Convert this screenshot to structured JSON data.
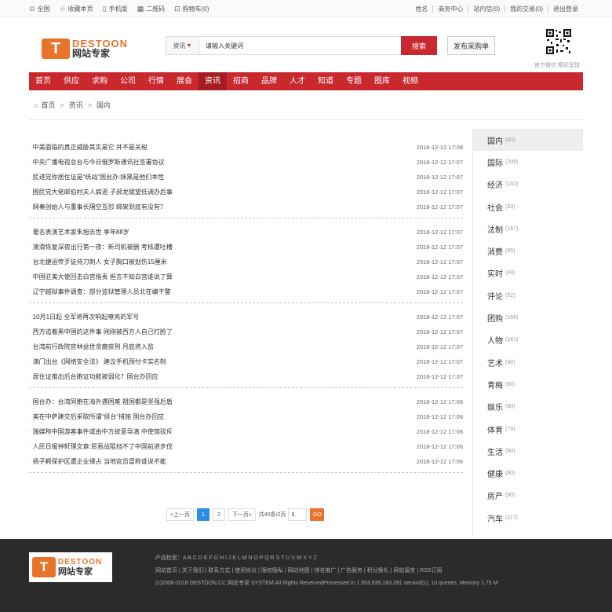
{
  "topbar": {
    "left": [
      {
        "icon": "location-icon",
        "label": "全国"
      },
      {
        "icon": "star-icon",
        "label": "收藏本页"
      },
      {
        "icon": "mobile-icon",
        "label": "手机版"
      },
      {
        "icon": "qrcode-icon",
        "label": "二维码"
      },
      {
        "icon": "cart-icon",
        "label": "购物车(0)"
      }
    ],
    "right": [
      "姓名",
      "商务中心",
      "站内信(0)",
      "我的交易(0)",
      "退出登录"
    ]
  },
  "header": {
    "logo_en": "DESTOON",
    "logo_cn": "网站专家",
    "search_type": "资讯",
    "search_value": "请输入关键词",
    "search_button": "搜索",
    "publish_button": "发布采购单",
    "qr_caption": "官方微信 精彩呈现"
  },
  "nav": {
    "active": 6,
    "items": [
      "首页",
      "供应",
      "求购",
      "公司",
      "行情",
      "展会",
      "资讯",
      "招商",
      "品牌",
      "人才",
      "知道",
      "专题",
      "图库",
      "视频"
    ]
  },
  "breadcrumb": [
    "首页",
    "资讯",
    "国内"
  ],
  "news_groups": [
    [
      {
        "title": "中美面临的真正威胁其实是它 并不是关税",
        "date": "2018-12-12 17:08"
      },
      {
        "title": "中央广播电视总台与今日俄罗斯通讯社签署协议",
        "date": "2018-12-12 17:07"
      },
      {
        "title": "民进党你居住证是“统战”国台办:抹黑是他们本性",
        "date": "2018-12-12 17:07"
      },
      {
        "title": "国民党大佬邮伯村夫人病逝 子郝龙斌望低调办后事",
        "date": "2018-12-12 17:07"
      },
      {
        "title": "网奏创始人与董事长隔空互怼 绑架到底有没有？",
        "date": "2018-12-12 17:07"
      }
    ],
    [
      {
        "title": "著名表演艺术家朱旭去世 享年88岁",
        "date": "2018-12-12 17:07"
      },
      {
        "title": "澳滑恢复深夜出行第一夜：新司机被删 考核遭吐槽",
        "date": "2018-12-12 17:07"
      },
      {
        "title": "台北捷运传歹徒持刀刺人 女子胸口被划伤15厘米",
        "date": "2018-12-12 17:07"
      },
      {
        "title": "中国驻美大使回击白宫指责 担言不知白宫谁说了算",
        "date": "2018-12-12 17:07"
      },
      {
        "title": "辽宁越狱事件调查：部分监狱管理人员北在编干警",
        "date": "2018-12-12 17:07"
      }
    ],
    [
      {
        "title": "10月1日起 全军将再次响起嘹亮的军号",
        "date": "2018-12-12 17:07"
      },
      {
        "title": "西方追着黑中国的这件事 刚刚被西方人自己打脸了",
        "date": "2018-12-12 17:07"
      },
      {
        "title": "台湾前行政院官林益世贪腐获刑 月底将入监",
        "date": "2018-12-12 17:07"
      },
      {
        "title": "澳门出台《网络安全法》 建议手机预付卡实名制",
        "date": "2018-12-12 17:07"
      },
      {
        "title": "居住证推出后台胞证功能被弱化？国台办回应",
        "date": "2018-12-12 17:07"
      }
    ],
    [
      {
        "title": "国台办：台湾同胞在海外遇困难 祖国都是坚强后盾",
        "date": "2018-12-12 17:06"
      },
      {
        "title": "美在中萨建交后采取所谓“挺台”措施 国台办回应",
        "date": "2018-12-12 17:06"
      },
      {
        "title": "瑞媒称中国游客事件或由中方故意导演 中使馆驳斥",
        "date": "2018-12-12 17:06"
      },
      {
        "title": "人民日报钟轩理文章:贸易战阻挡不了中国前进步伐",
        "date": "2018-12-12 17:06"
      },
      {
        "title": "扬子鳄保护区遭企业侵占 当地官员冒称谁说不能",
        "date": "2018-12-12 17:06"
      }
    ]
  ],
  "sidebar": {
    "active": 0,
    "items": [
      {
        "label": "国内",
        "count": "(40)"
      },
      {
        "label": "国际",
        "count": "(209)"
      },
      {
        "label": "经济",
        "count": "(162)"
      },
      {
        "label": "社会",
        "count": "(83)"
      },
      {
        "label": "法制",
        "count": "(167)"
      },
      {
        "label": "消费",
        "count": "(85)"
      },
      {
        "label": "实时",
        "count": "(49)"
      },
      {
        "label": "评论",
        "count": "(52)"
      },
      {
        "label": "团购",
        "count": "(166)"
      },
      {
        "label": "人物",
        "count": "(161)"
      },
      {
        "label": "艺术",
        "count": "(40)"
      },
      {
        "label": "青梅",
        "count": "(80)"
      },
      {
        "label": "娱乐",
        "count": "(80)"
      },
      {
        "label": "体育",
        "count": "(79)"
      },
      {
        "label": "生活",
        "count": "(80)"
      },
      {
        "label": "健康",
        "count": "(80)"
      },
      {
        "label": "房产",
        "count": "(80)"
      },
      {
        "label": "汽车",
        "count": "(117)"
      }
    ]
  },
  "pager": {
    "prev": "«上一页",
    "pages": [
      "1",
      "2"
    ],
    "current": "1",
    "next": "下一页»",
    "summary": "共40条/2页",
    "input_value": "1",
    "go": "GO"
  },
  "footer": {
    "logo_en": "DESTOON",
    "logo_cn": "网站专家",
    "line1": "产品检索：A B C D E F G H I J K L M N O P Q R S T U V W X Y Z",
    "line2": "网站首页 | 关于我们 | 联系方式 | 使用协议 | 版权隐私 | 网站地图 | 排名推广 | 广告服务 | 积分换礼 | 网站留言 | RSS订阅",
    "line3": "(c)2008-2018 DESTOON.CC 网站专家 SYSTEM All Rights ReservedProcessed in 1.553,939,183,281 second(s), 10 queries, Memory 1.75 M"
  },
  "colors": {
    "brand_red": "#c8282e",
    "logo_orange": "#e8732b",
    "page_blue": "#2b8de4",
    "footer_bg": "#2b2b2b"
  }
}
